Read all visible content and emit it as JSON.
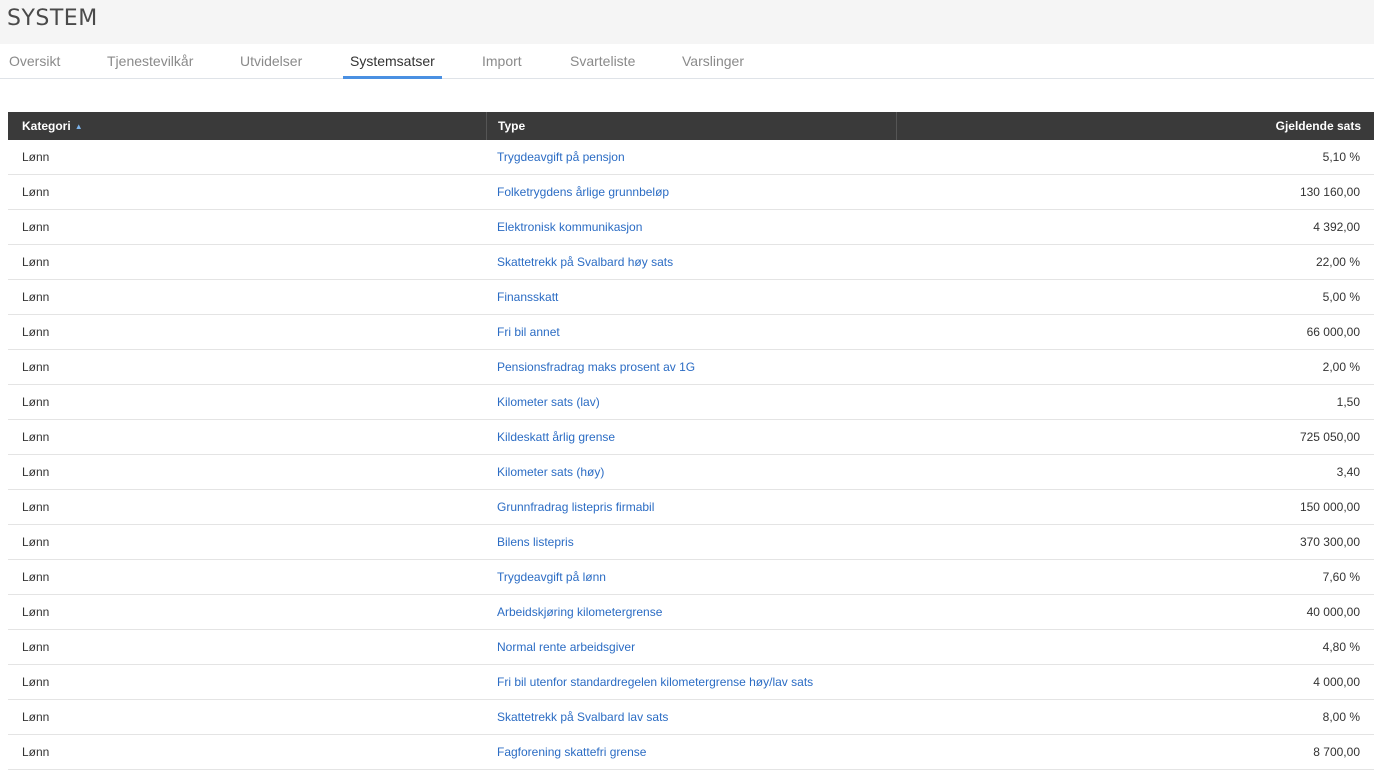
{
  "page": {
    "title": "SYSTEM"
  },
  "tabs": [
    {
      "label": "Oversikt",
      "active": false
    },
    {
      "label": "Tjenestevilkår",
      "active": false
    },
    {
      "label": "Utvidelser",
      "active": false
    },
    {
      "label": "Systemsatser",
      "active": true
    },
    {
      "label": "Import",
      "active": false
    },
    {
      "label": "Svarteliste",
      "active": false
    },
    {
      "label": "Varslinger",
      "active": false
    }
  ],
  "table": {
    "columns": {
      "kategori": "Kategori",
      "type": "Type",
      "sats": "Gjeldende sats"
    },
    "sort_icon": "▲",
    "rows": [
      {
        "kategori": "Lønn",
        "type": "Trygdeavgift på pensjon",
        "sats": "5,10 %"
      },
      {
        "kategori": "Lønn",
        "type": "Folketrygdens årlige grunnbeløp",
        "sats": "130 160,00"
      },
      {
        "kategori": "Lønn",
        "type": "Elektronisk kommunikasjon",
        "sats": "4 392,00"
      },
      {
        "kategori": "Lønn",
        "type": "Skattetrekk på Svalbard høy sats",
        "sats": "22,00 %"
      },
      {
        "kategori": "Lønn",
        "type": "Finansskatt",
        "sats": "5,00 %"
      },
      {
        "kategori": "Lønn",
        "type": "Fri bil annet",
        "sats": "66 000,00"
      },
      {
        "kategori": "Lønn",
        "type": "Pensionsfradrag maks prosent av 1G",
        "sats": "2,00 %"
      },
      {
        "kategori": "Lønn",
        "type": "Kilometer sats (lav)",
        "sats": "1,50"
      },
      {
        "kategori": "Lønn",
        "type": "Kildeskatt årlig grense",
        "sats": "725 050,00"
      },
      {
        "kategori": "Lønn",
        "type": "Kilometer sats (høy)",
        "sats": "3,40"
      },
      {
        "kategori": "Lønn",
        "type": "Grunnfradrag listepris firmabil",
        "sats": "150 000,00"
      },
      {
        "kategori": "Lønn",
        "type": "Bilens listepris",
        "sats": "370 300,00"
      },
      {
        "kategori": "Lønn",
        "type": "Trygdeavgift på lønn",
        "sats": "7,60 %"
      },
      {
        "kategori": "Lønn",
        "type": "Arbeidskjøring kilometergrense",
        "sats": "40 000,00"
      },
      {
        "kategori": "Lønn",
        "type": "Normal rente arbeidsgiver",
        "sats": "4,80 %"
      },
      {
        "kategori": "Lønn",
        "type": "Fri bil utenfor standardregelen kilometergrense høy/lav sats",
        "sats": "4 000,00"
      },
      {
        "kategori": "Lønn",
        "type": "Skattetrekk på Svalbard lav sats",
        "sats": "8,00 %"
      },
      {
        "kategori": "Lønn",
        "type": "Fagforening skattefri grense",
        "sats": "8 700,00"
      }
    ]
  }
}
